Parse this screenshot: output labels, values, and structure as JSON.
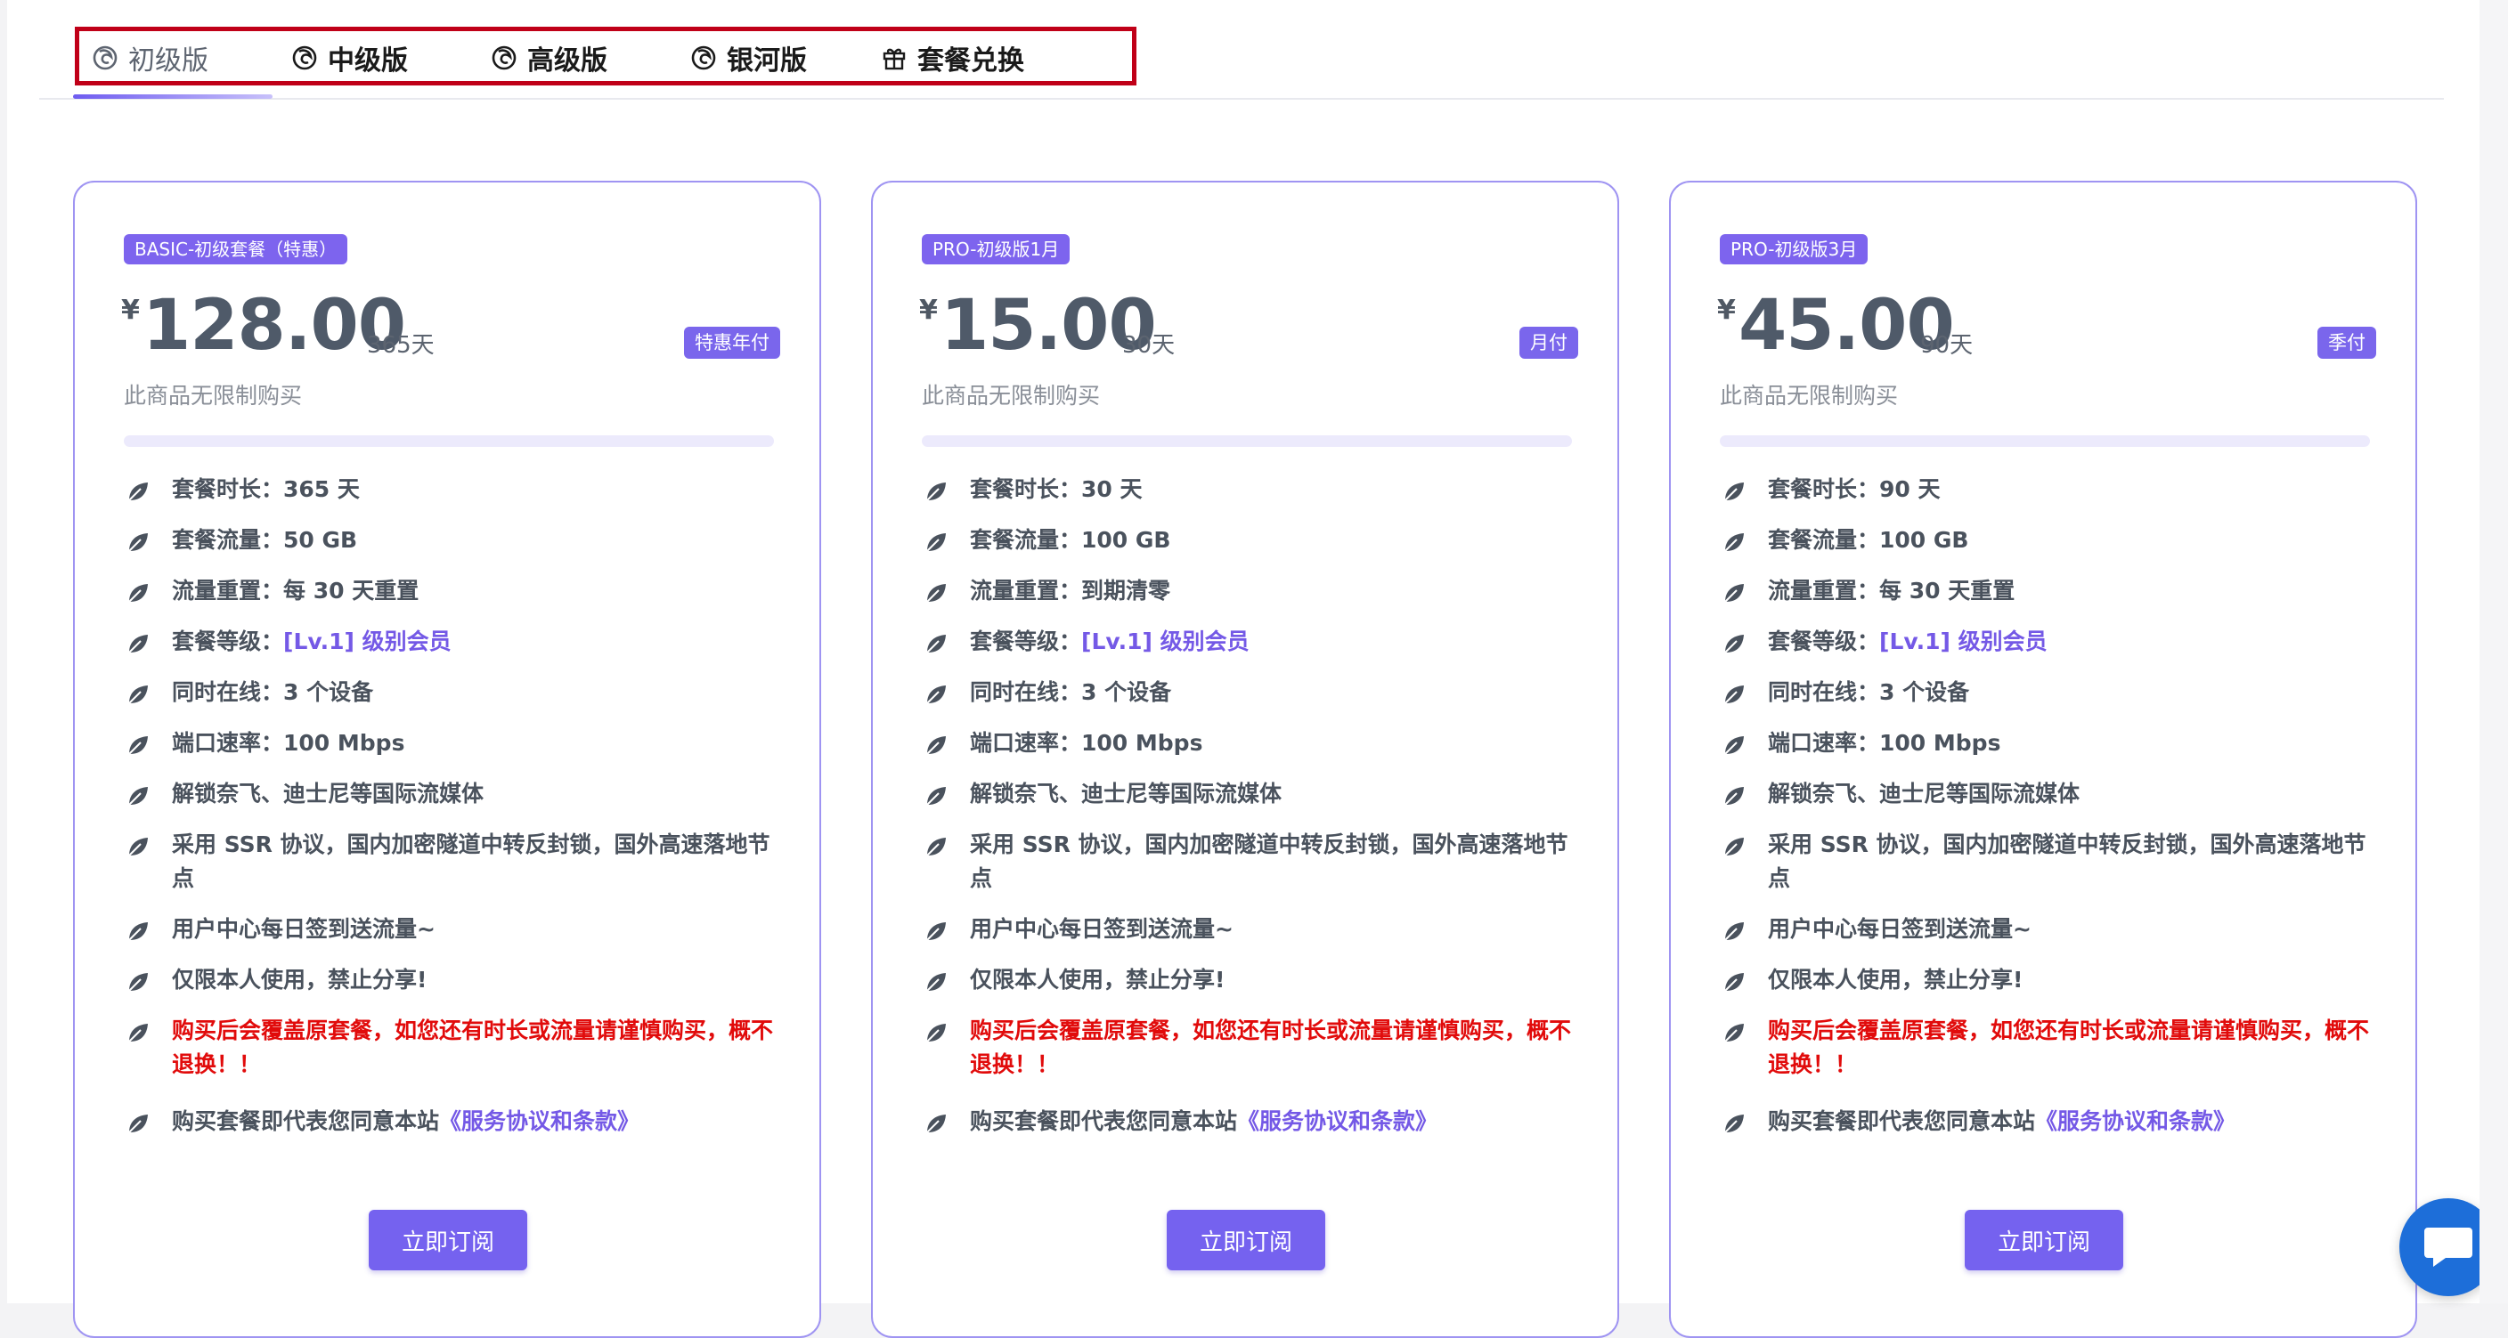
{
  "tabs": [
    {
      "label": "初级版",
      "icon": "firefox-icon",
      "active": true
    },
    {
      "label": "中级版",
      "icon": "firefox-icon",
      "active": false
    },
    {
      "label": "高级版",
      "icon": "firefox-icon",
      "active": false
    },
    {
      "label": "银河版",
      "icon": "firefox-icon",
      "active": false
    },
    {
      "label": "套餐兑换",
      "icon": "gift-icon",
      "active": false
    }
  ],
  "colors": {
    "accent": "#7562ef",
    "highlight_border": "#c00018",
    "warning": "#e10b0b",
    "chat": "#1d6ed9"
  },
  "plans": [
    {
      "badge": "BASIC-初级套餐（特惠）",
      "currency": "¥",
      "price": "128.00",
      "period": "365天",
      "pay_tag": "特惠年付",
      "limit_note": "此商品无限制购买",
      "features": {
        "duration": {
          "label": "套餐时长：",
          "value": "365 天"
        },
        "traffic": {
          "label": "套餐流量：",
          "value": "50 GB"
        },
        "reset": {
          "label": "流量重置：",
          "value": "每 30 天重置"
        },
        "level": {
          "label": "套餐等级：",
          "value": "[Lv.1] 级别会员"
        },
        "devices": {
          "label": "同时在线：",
          "value": "3 个设备"
        },
        "speed": {
          "label": "端口速率：",
          "value": "100 Mbps"
        },
        "streaming": "解锁奈飞、迪士尼等国际流媒体",
        "protocol": "采用 SSR 协议，国内加密隧道中转反封锁，国外高速落地节点",
        "checkin": "用户中心每日签到送流量~",
        "personal": "仅限本人使用，禁止分享!",
        "warning": "购买后会覆盖原套餐，如您还有时长或流量请谨慎购买，概不退换！！",
        "terms_prefix": "购买套餐即代表您同意本站",
        "terms_link": "《服务协议和条款》"
      },
      "button": "立即订阅"
    },
    {
      "badge": "PRO-初级版1月",
      "currency": "¥",
      "price": "15.00",
      "period": "30天",
      "pay_tag": "月付",
      "limit_note": "此商品无限制购买",
      "features": {
        "duration": {
          "label": "套餐时长：",
          "value": "30 天"
        },
        "traffic": {
          "label": "套餐流量：",
          "value": "100 GB"
        },
        "reset": {
          "label": "流量重置：",
          "value": "到期清零"
        },
        "level": {
          "label": "套餐等级：",
          "value": "[Lv.1] 级别会员"
        },
        "devices": {
          "label": "同时在线：",
          "value": "3 个设备"
        },
        "speed": {
          "label": "端口速率：",
          "value": "100 Mbps"
        },
        "streaming": "解锁奈飞、迪士尼等国际流媒体",
        "protocol": "采用 SSR 协议，国内加密隧道中转反封锁，国外高速落地节点",
        "checkin": "用户中心每日签到送流量~",
        "personal": "仅限本人使用，禁止分享!",
        "warning": "购买后会覆盖原套餐，如您还有时长或流量请谨慎购买，概不退换！！",
        "terms_prefix": "购买套餐即代表您同意本站",
        "terms_link": "《服务协议和条款》"
      },
      "button": "立即订阅"
    },
    {
      "badge": "PRO-初级版3月",
      "currency": "¥",
      "price": "45.00",
      "period": "90天",
      "pay_tag": "季付",
      "limit_note": "此商品无限制购买",
      "features": {
        "duration": {
          "label": "套餐时长：",
          "value": "90 天"
        },
        "traffic": {
          "label": "套餐流量：",
          "value": "100 GB"
        },
        "reset": {
          "label": "流量重置：",
          "value": "每 30 天重置"
        },
        "level": {
          "label": "套餐等级：",
          "value": "[Lv.1] 级别会员"
        },
        "devices": {
          "label": "同时在线：",
          "value": "3 个设备"
        },
        "speed": {
          "label": "端口速率：",
          "value": "100 Mbps"
        },
        "streaming": "解锁奈飞、迪士尼等国际流媒体",
        "protocol": "采用 SSR 协议，国内加密隧道中转反封锁，国外高速落地节点",
        "checkin": "用户中心每日签到送流量~",
        "personal": "仅限本人使用，禁止分享!",
        "warning": "购买后会覆盖原套餐，如您还有时长或流量请谨慎购买，概不退换！！",
        "terms_prefix": "购买套餐即代表您同意本站",
        "terms_link": "《服务协议和条款》"
      },
      "button": "立即订阅"
    }
  ],
  "chat": {
    "icon": "chat-icon"
  }
}
